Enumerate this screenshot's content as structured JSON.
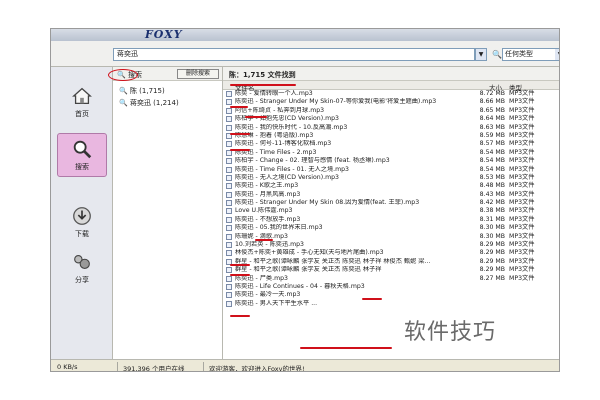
{
  "app": {
    "logo": "FOXY"
  },
  "search": {
    "query": "蒋奕迅",
    "drop_arrow": "▼",
    "type_label": "任何类型",
    "type_arrow": "▼",
    "button": "搜索"
  },
  "nav": [
    {
      "label": "首页",
      "icon": "home-icon"
    },
    {
      "label": "搜索",
      "icon": "search-icon",
      "active": true
    },
    {
      "label": "下载",
      "icon": "download-icon"
    },
    {
      "label": "分享",
      "icon": "share-icon"
    }
  ],
  "tree": {
    "header": "搜索",
    "delete_button": "删除搜索",
    "nodes": [
      "陈 (1,715)",
      "蒋奕迅 (1,214)"
    ]
  },
  "results": {
    "header": "陈：1,715 文件找到",
    "columns": {
      "name": "文件名",
      "size": "大小",
      "type": "类型"
    },
    "rows": [
      {
        "name": "陈奕 - 爱情转眼一个人.mp3",
        "size": "8.72 MB",
        "type": "MP3文件"
      },
      {
        "name": "陈奕迅 - Stranger Under My Skin-07-等你爱我(电影'将爱主题曲).mp3",
        "size": "8.66 MB",
        "type": "MP3文件"
      },
      {
        "name": "阿信+陈绮贞 - 私奔到月球.mp3",
        "size": "8.65 MB",
        "type": "MP3文件"
      },
      {
        "name": "陈柏宇 - 如抱先忠(CD Version).mp3",
        "size": "8.64 MB",
        "type": "MP3文件"
      },
      {
        "name": "陈奕迅 - 我的快乐时代 - 10.反高潮.mp3",
        "size": "8.63 MB",
        "type": "MP3文件"
      },
      {
        "name": "陈慧琳 - 抱着 (粤语版).mp3",
        "size": "8.59 MB",
        "type": "MP3文件"
      },
      {
        "name": "陈奕迅 - 何号-11-博客化软档.mp3",
        "size": "8.57 MB",
        "type": "MP3文件"
      },
      {
        "name": "陈奕迅 - Time Files - 2.mp3",
        "size": "8.54 MB",
        "type": "MP3文件"
      },
      {
        "name": "陈柏宇 - Change - 02. 理智与感情 (feat. 杨丞琳).mp3",
        "size": "8.54 MB",
        "type": "MP3文件"
      },
      {
        "name": "陈奕迅 - Time Files - 01. 无人之境.mp3",
        "size": "8.54 MB",
        "type": "MP3文件"
      },
      {
        "name": "陈奕迅 - 无人之境(CD Version).mp3",
        "size": "8.53 MB",
        "type": "MP3文件"
      },
      {
        "name": "陈奕迅 - K歌之王.mp3",
        "size": "8.48 MB",
        "type": "MP3文件"
      },
      {
        "name": "陈奕迅 - 月黑风高.mp3",
        "size": "8.43 MB",
        "type": "MP3文件"
      },
      {
        "name": "陈奕迅 - Stranger Under My Skin 08.因为爱情(feat. 王菲).mp3",
        "size": "8.42 MB",
        "type": "MP3文件"
      },
      {
        "name": "Love U.陈伟霆.mp3",
        "size": "8.38 MB",
        "type": "MP3文件"
      },
      {
        "name": "陈奕迅 - 不想放手.mp3",
        "size": "8.31 MB",
        "type": "MP3文件"
      },
      {
        "name": "陈奕迅 - 05.我的世界末日.mp3",
        "size": "8.30 MB",
        "type": "MP3文件"
      },
      {
        "name": "陈珊妮 - 滴歌.mp3",
        "size": "8.30 MB",
        "type": "MP3文件"
      },
      {
        "name": "10.刘若英 - 陈奕迅.mp3",
        "size": "8.29 MB",
        "type": "MP3文件"
      },
      {
        "name": "林俊杰+陈奕+黄雄成 - 手心无知(天与地片尾曲).mp3",
        "size": "8.29 MB",
        "type": "MP3文件"
      },
      {
        "name": "群星 - 和平之歌(谭咏麟 张学友 关正杰 陈奕迅 林子祥 林俊杰 甄妮 梁...",
        "size": "8.29 MB",
        "type": "MP3文件"
      },
      {
        "name": "群星 - 和平之歌(谭咏麟 张学友 关正杰 陈奕迅 林子祥",
        "size": "8.29 MB",
        "type": "MP3文件"
      },
      {
        "name": "陈奕迅 - 尸类.mp3",
        "size": "8.27 MB",
        "type": "MP3文件"
      },
      {
        "name": "陈奕迅 - Life Continues - 04 - 暮秋天格.mp3",
        "size": "",
        "type": ""
      },
      {
        "name": "陈奕迅 - 最冷一天.mp3",
        "size": "",
        "type": ""
      },
      {
        "name": "陈奕迅 - 男人天下平生水平 ...",
        "size": "",
        "type": ""
      }
    ]
  },
  "status": {
    "speed": "0 KB/s",
    "users": "391,396 个用户在线",
    "message": "欢迎游客，欢迎进入Foxy的世界!"
  },
  "watermark": "软件技巧",
  "colors": {
    "accent_red": "#d0101a",
    "active_nav": "#e9b7e0",
    "brand": "#1a2f6e"
  }
}
